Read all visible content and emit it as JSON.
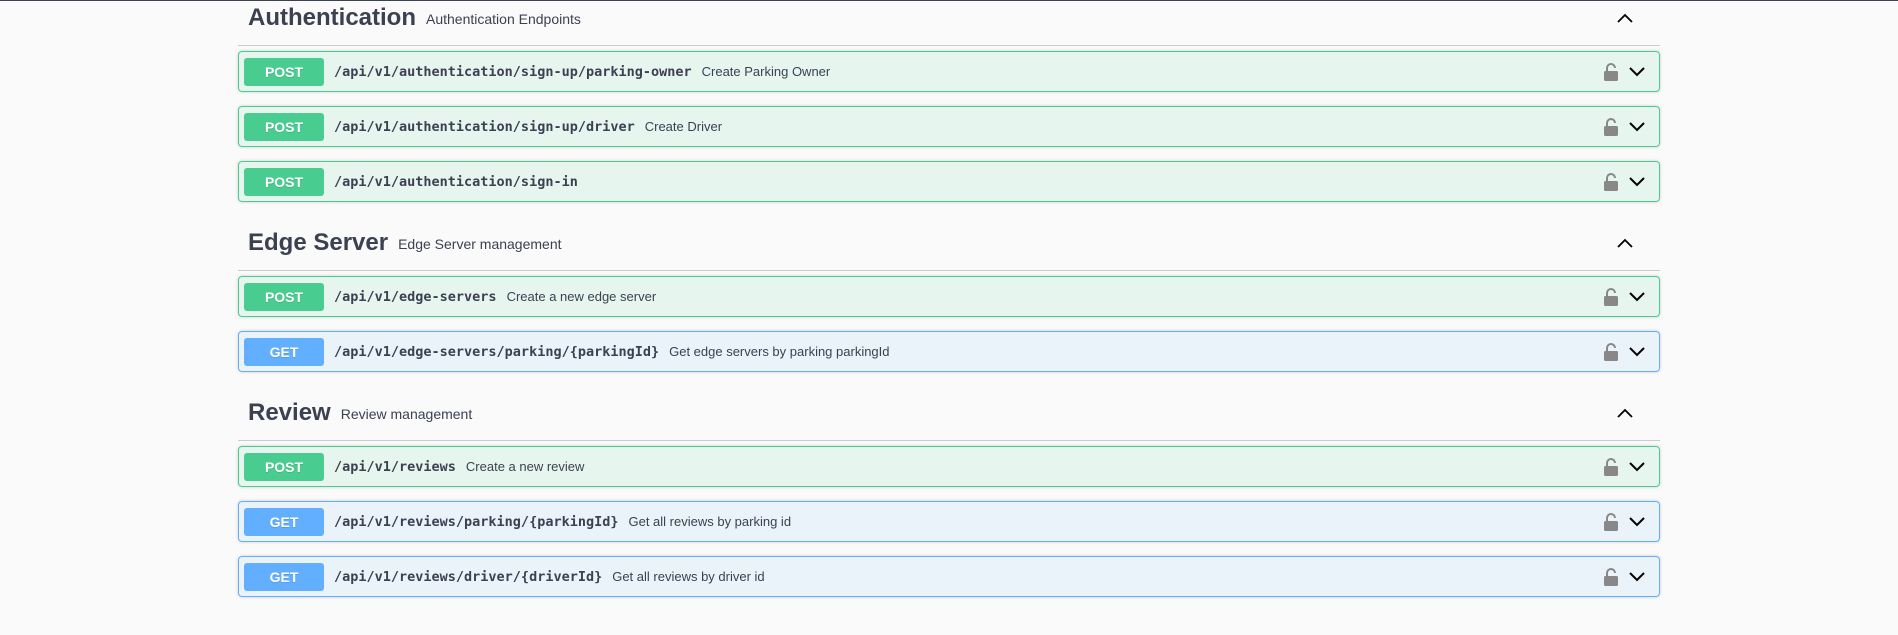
{
  "sections": [
    {
      "title": "Authentication",
      "description": "Authentication Endpoints",
      "operations": [
        {
          "method": "POST",
          "path": "/api/v1/authentication/sign-up/parking-owner",
          "summary": "Create Parking Owner"
        },
        {
          "method": "POST",
          "path": "/api/v1/authentication/sign-up/driver",
          "summary": "Create Driver"
        },
        {
          "method": "POST",
          "path": "/api/v1/authentication/sign-in",
          "summary": ""
        }
      ]
    },
    {
      "title": "Edge Server",
      "description": "Edge Server management",
      "operations": [
        {
          "method": "POST",
          "path": "/api/v1/edge-servers",
          "summary": "Create a new edge server"
        },
        {
          "method": "GET",
          "path": "/api/v1/edge-servers/parking/{parkingId}",
          "summary": "Get edge servers by parking parkingId"
        }
      ]
    },
    {
      "title": "Review",
      "description": "Review management",
      "operations": [
        {
          "method": "POST",
          "path": "/api/v1/reviews",
          "summary": "Create a new review"
        },
        {
          "method": "GET",
          "path": "/api/v1/reviews/parking/{parkingId}",
          "summary": "Get all reviews by parking id"
        },
        {
          "method": "GET",
          "path": "/api/v1/reviews/driver/{driverId}",
          "summary": "Get all reviews by driver id"
        }
      ]
    }
  ],
  "icons": {
    "section_toggle": "chevron-up-icon",
    "operation_lock": "lock-icon",
    "operation_expand": "chevron-down-icon"
  },
  "colors": {
    "post": "#49cc90",
    "get": "#61affe",
    "text": "#3b4151"
  }
}
